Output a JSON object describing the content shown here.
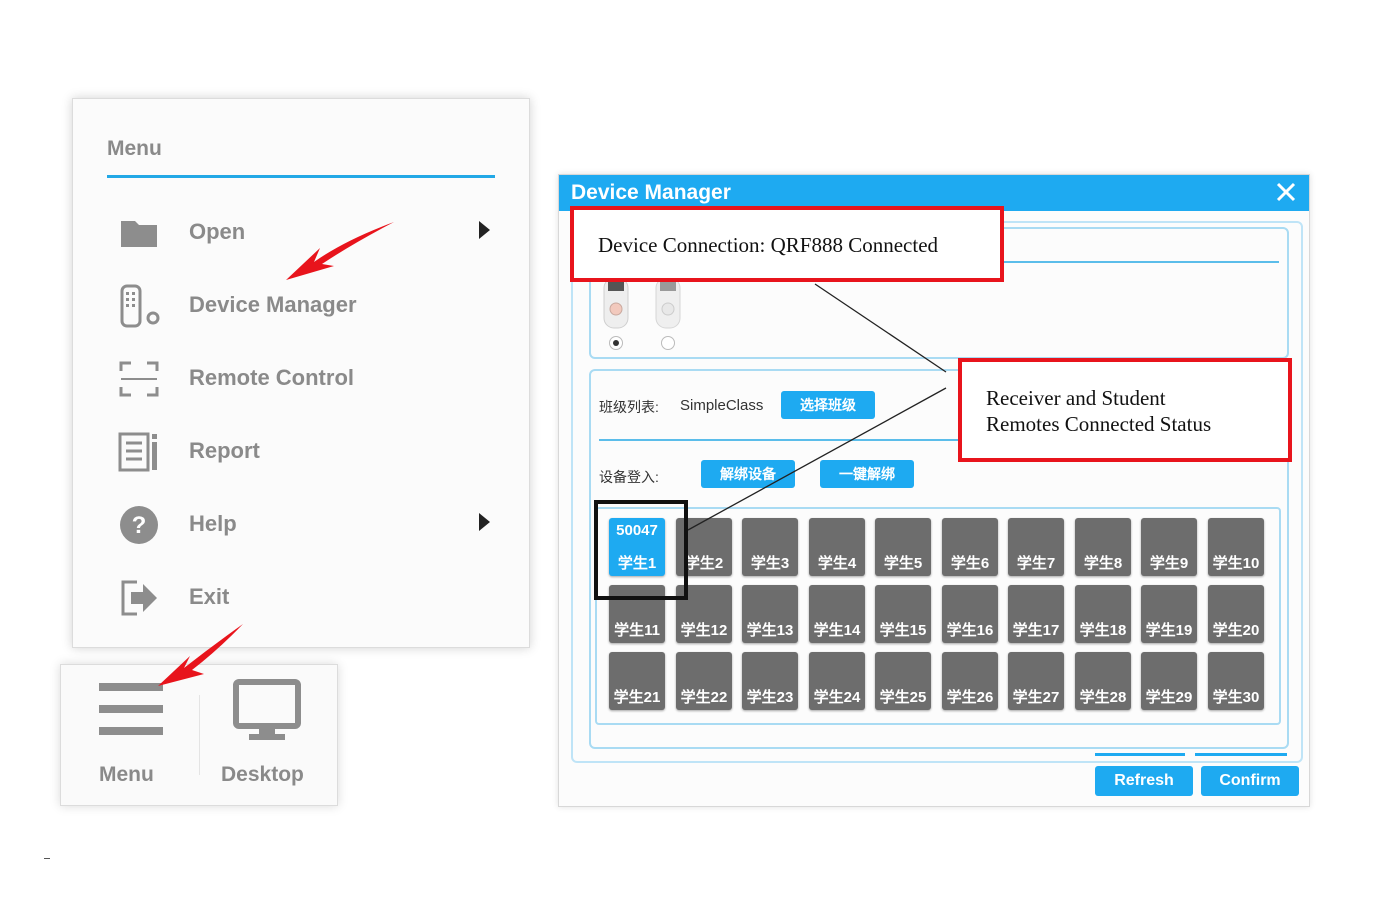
{
  "menu": {
    "title": "Menu",
    "items": [
      {
        "label": "Open",
        "icon": "folder-icon",
        "has_submenu": true
      },
      {
        "label": "Device Manager",
        "icon": "device-remote-icon",
        "has_submenu": false
      },
      {
        "label": "Remote Control",
        "icon": "remote-control-frame-icon",
        "has_submenu": false
      },
      {
        "label": "Report",
        "icon": "report-icon",
        "has_submenu": false
      },
      {
        "label": "Help",
        "icon": "help-icon",
        "has_submenu": true
      },
      {
        "label": "Exit",
        "icon": "exit-icon",
        "has_submenu": false
      }
    ]
  },
  "taskbar": {
    "menu_label": "Menu",
    "desktop_label": "Desktop"
  },
  "device_manager": {
    "title": "Device Manager",
    "class_list_label": "班级列表:",
    "class_name": "SimpleClass",
    "select_class_button": "选择班级",
    "device_login_label": "设备登入:",
    "unbind_device_button": "解绑设备",
    "unbind_all_button": "一键解绑",
    "refresh_button": "Refresh",
    "confirm_button": "Confirm",
    "students": [
      {
        "name": "学生1",
        "id": "50047",
        "active": true
      },
      {
        "name": "学生2"
      },
      {
        "name": "学生3"
      },
      {
        "name": "学生4"
      },
      {
        "name": "学生5"
      },
      {
        "name": "学生6"
      },
      {
        "name": "学生7"
      },
      {
        "name": "学生8"
      },
      {
        "name": "学生9"
      },
      {
        "name": "学生10"
      },
      {
        "name": "学生11"
      },
      {
        "name": "学生12"
      },
      {
        "name": "学生13"
      },
      {
        "name": "学生14"
      },
      {
        "name": "学生15"
      },
      {
        "name": "学生16"
      },
      {
        "name": "学生17"
      },
      {
        "name": "学生18"
      },
      {
        "name": "学生19"
      },
      {
        "name": "学生20"
      },
      {
        "name": "学生21"
      },
      {
        "name": "学生22"
      },
      {
        "name": "学生23"
      },
      {
        "name": "学生24"
      },
      {
        "name": "学生25"
      },
      {
        "name": "学生26"
      },
      {
        "name": "学生27"
      },
      {
        "name": "学生28"
      },
      {
        "name": "学生29"
      },
      {
        "name": "学生30"
      }
    ]
  },
  "annotations": {
    "connection": "Device Connection: QRF888 Connected",
    "status_line1": "Receiver and Student",
    "status_line2": "Remotes Connected Status"
  },
  "colors": {
    "accent": "#1eaaf1",
    "callout_red": "#e8141c",
    "arrow_red": "#e8141c",
    "tile_gray": "#6d6d6d",
    "menu_text": "#8a8a8a"
  }
}
